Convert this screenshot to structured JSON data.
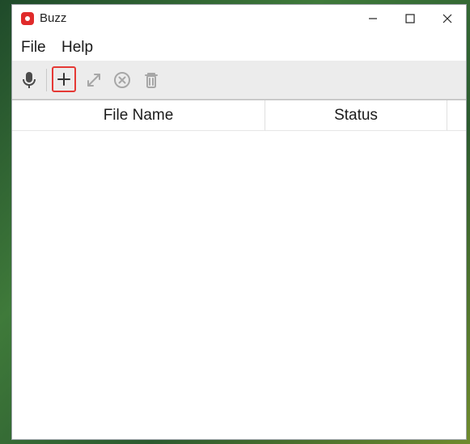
{
  "window": {
    "title": "Buzz"
  },
  "menubar": {
    "file_label": "File",
    "help_label": "Help"
  },
  "toolbar": {
    "record_icon": "microphone-icon",
    "add_icon": "plus-icon",
    "expand_icon": "expand-icon",
    "cancel_icon": "cancel-icon",
    "delete_icon": "trash-icon",
    "highlight_color": "#e53935"
  },
  "table": {
    "headers": [
      "File Name",
      "Status"
    ],
    "rows": []
  }
}
